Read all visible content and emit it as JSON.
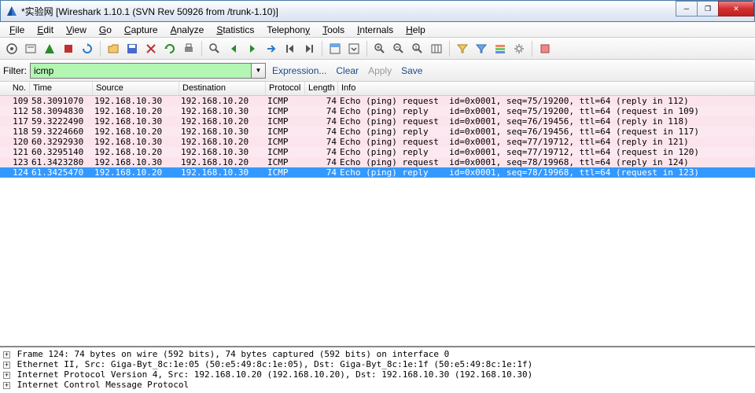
{
  "window": {
    "title": "*实验网   [Wireshark 1.10.1  (SVN Rev 50926 from /trunk-1.10)]"
  },
  "menu": [
    "File",
    "Edit",
    "View",
    "Go",
    "Capture",
    "Analyze",
    "Statistics",
    "Telephony",
    "Tools",
    "Internals",
    "Help"
  ],
  "filter": {
    "label": "Filter:",
    "value": "icmp",
    "expression": "Expression...",
    "clear": "Clear",
    "apply": "Apply",
    "save": "Save"
  },
  "columns": {
    "no": "No.",
    "time": "Time",
    "source": "Source",
    "destination": "Destination",
    "protocol": "Protocol",
    "length": "Length",
    "info": "Info"
  },
  "packets": [
    {
      "no": "109",
      "time": "58.3091070",
      "src": "192.168.10.30",
      "dst": "192.168.10.20",
      "proto": "ICMP",
      "len": "74",
      "info": "Echo (ping) request  id=0x0001, seq=75/19200, ttl=64 (reply in 112)",
      "cls": "pink"
    },
    {
      "no": "112",
      "time": "58.3094830",
      "src": "192.168.10.20",
      "dst": "192.168.10.30",
      "proto": "ICMP",
      "len": "74",
      "info": "Echo (ping) reply    id=0x0001, seq=75/19200, ttl=64 (request in 109)",
      "cls": "lpink"
    },
    {
      "no": "117",
      "time": "59.3222490",
      "src": "192.168.10.30",
      "dst": "192.168.10.20",
      "proto": "ICMP",
      "len": "74",
      "info": "Echo (ping) request  id=0x0001, seq=76/19456, ttl=64 (reply in 118)",
      "cls": "pink"
    },
    {
      "no": "118",
      "time": "59.3224660",
      "src": "192.168.10.20",
      "dst": "192.168.10.30",
      "proto": "ICMP",
      "len": "74",
      "info": "Echo (ping) reply    id=0x0001, seq=76/19456, ttl=64 (request in 117)",
      "cls": "lpink"
    },
    {
      "no": "120",
      "time": "60.3292930",
      "src": "192.168.10.30",
      "dst": "192.168.10.20",
      "proto": "ICMP",
      "len": "74",
      "info": "Echo (ping) request  id=0x0001, seq=77/19712, ttl=64 (reply in 121)",
      "cls": "pink"
    },
    {
      "no": "121",
      "time": "60.3295140",
      "src": "192.168.10.20",
      "dst": "192.168.10.30",
      "proto": "ICMP",
      "len": "74",
      "info": "Echo (ping) reply    id=0x0001, seq=77/19712, ttl=64 (request in 120)",
      "cls": "lpink"
    },
    {
      "no": "123",
      "time": "61.3423280",
      "src": "192.168.10.30",
      "dst": "192.168.10.20",
      "proto": "ICMP",
      "len": "74",
      "info": "Echo (ping) request  id=0x0001, seq=78/19968, ttl=64 (reply in 124)",
      "cls": "pink"
    },
    {
      "no": "124",
      "time": "61.3425470",
      "src": "192.168.10.20",
      "dst": "192.168.10.30",
      "proto": "ICMP",
      "len": "74",
      "info": "Echo (ping) reply    id=0x0001, seq=78/19968, ttl=64 (request in 123)",
      "cls": "selected"
    }
  ],
  "details": [
    "Frame 124: 74 bytes on wire (592 bits), 74 bytes captured (592 bits) on interface 0",
    "Ethernet II, Src: Giga-Byt_8c:1e:05 (50:e5:49:8c:1e:05), Dst: Giga-Byt_8c:1e:1f (50:e5:49:8c:1e:1f)",
    "Internet Protocol Version 4, Src: 192.168.10.20 (192.168.10.20), Dst: 192.168.10.30 (192.168.10.30)",
    "Internet Control Message Protocol"
  ]
}
